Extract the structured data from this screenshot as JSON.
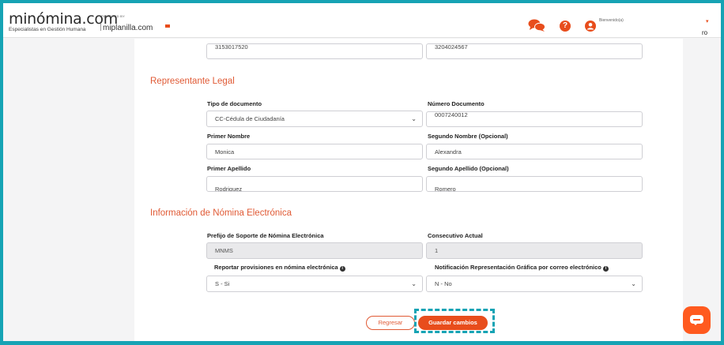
{
  "header": {
    "logo_text": "minómina.com",
    "logo_tagline": "Especialistas en Gestión Humana",
    "powered_by": "POWERED BY",
    "partner": "miplanilla.com",
    "user_name": "Bienvenido(a)",
    "user_role": "ro",
    "accent": "#e84d1c"
  },
  "top_fields": {
    "left_value": "3153017520",
    "right_value": "3204024567"
  },
  "legal_rep": {
    "title": "Representante Legal",
    "doc_type_label": "Tipo de documento",
    "doc_type_value": "CC-Cédula de Ciudadanía",
    "doc_number_label": "Número Documento",
    "doc_number_value": "0007240012",
    "first_name_label": "Primer Nombre",
    "first_name_value": "Monica",
    "second_name_label": "Segundo Nombre (Opcional)",
    "second_name_value": "Alexandra",
    "first_last_label": "Primer Apellido",
    "first_last_value": "Rodriguez",
    "second_last_label": "Segundo Apellido (Opcional)",
    "second_last_value": "Romero"
  },
  "payroll": {
    "title": "Información de Nómina Electrónica",
    "prefix_label": "Prefijo de Soporte de Nómina Electrónica",
    "prefix_value": "MNMS",
    "consecutive_label": "Consecutivo Actual",
    "consecutive_value": "1",
    "provisions_label": "Reportar provisiones en nómina electrónica",
    "provisions_value": "S - Si",
    "notification_label": "Notificación Representación Gráfica por correo electrónico",
    "notification_value": "N - No"
  },
  "actions": {
    "back_label": "Regresar",
    "save_label": "Guardar cambios"
  },
  "icons": {
    "chat": "chat-bubbles-icon",
    "help": "help-icon",
    "user": "user-icon",
    "select": "chevron-down-icon",
    "info": "info-icon",
    "fab": "chat-icon"
  }
}
